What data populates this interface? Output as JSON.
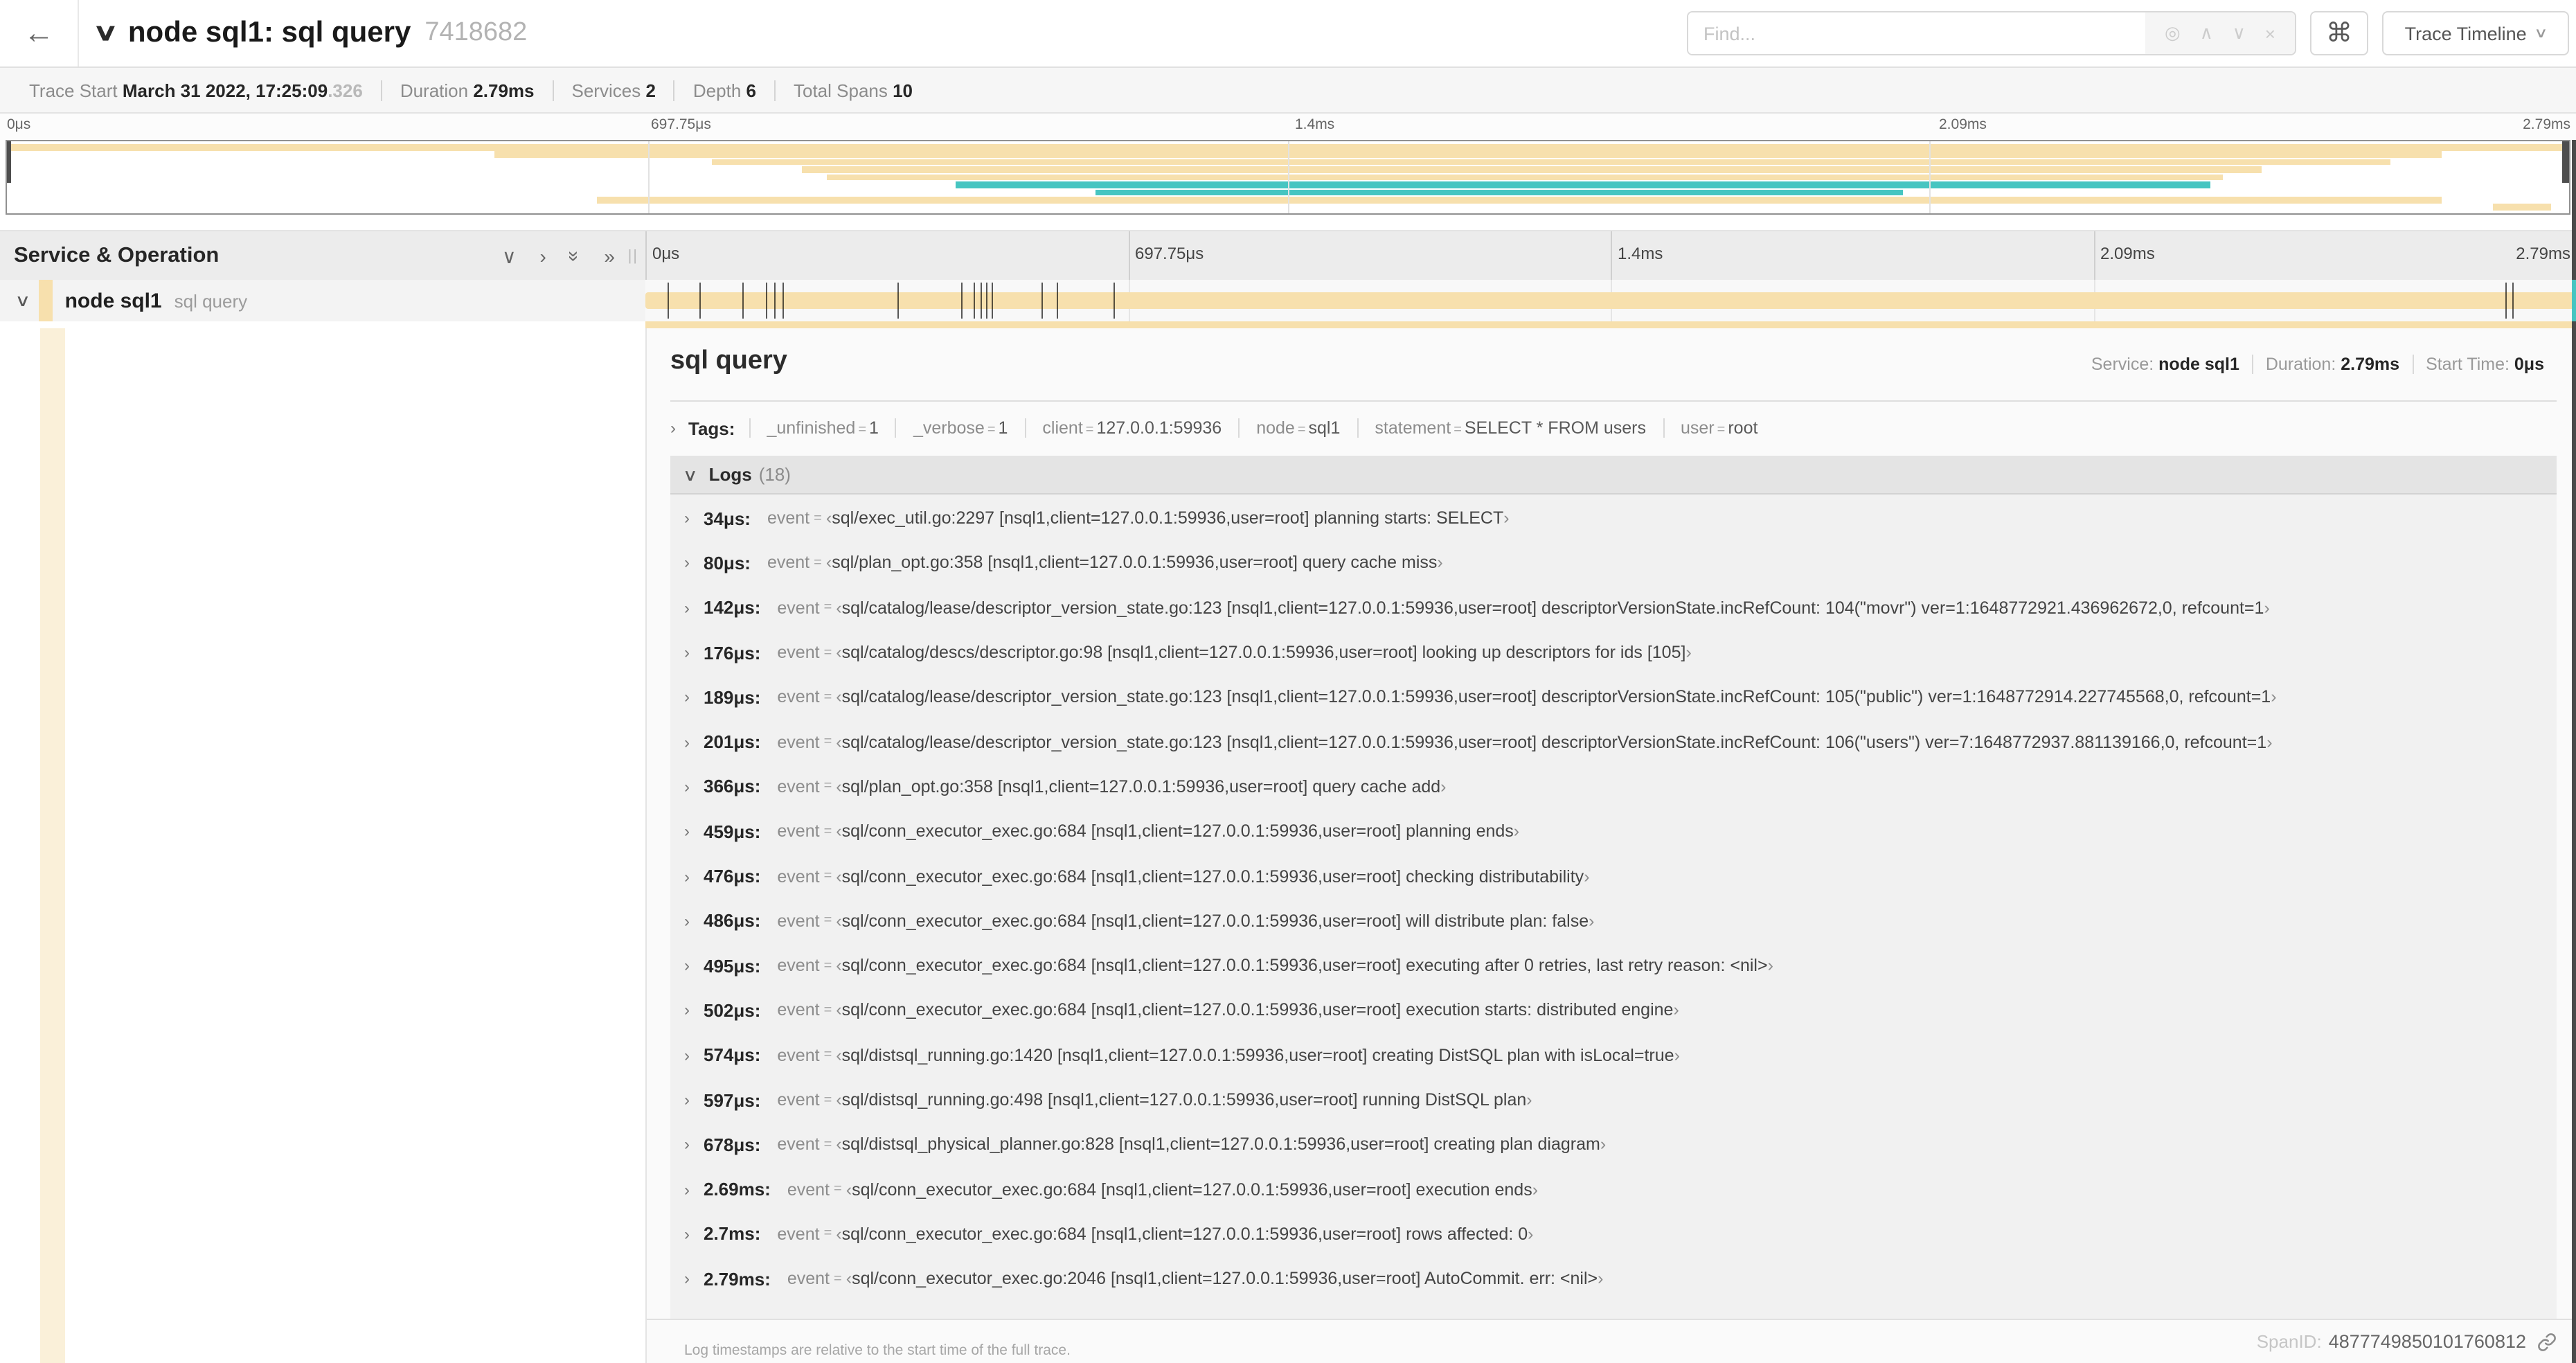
{
  "topbar": {
    "back_icon": "←",
    "collapse_icon": "∨",
    "title": "node sql1: sql query",
    "trace_id": "7418682",
    "find_placeholder": "Find...",
    "locate_icon": "◎",
    "prev_icon": "∧",
    "next_icon": "∨",
    "clear_icon": "×",
    "cmd_symbol": "⌘",
    "view_button": "Trace Timeline"
  },
  "meta": {
    "items": [
      {
        "label": "Trace Start",
        "value": "March 31 2022, 17:25:09",
        "suffix": ".326"
      },
      {
        "label": "Duration",
        "value": "2.79ms"
      },
      {
        "label": "Services",
        "value": "2"
      },
      {
        "label": "Depth",
        "value": "6"
      },
      {
        "label": "Total Spans",
        "value": "10"
      }
    ]
  },
  "timeline": {
    "axis_tick_labels": [
      "0μs",
      "697.75μs",
      "1.4ms",
      "2.09ms",
      "2.79ms"
    ],
    "axis_tick_percents": [
      0,
      25,
      50,
      75,
      100
    ],
    "header_left": "Service & Operation",
    "colors": {
      "tan": "#f7e0ad",
      "teal": "#46c5c1",
      "indent_tan": "#faf0d9"
    },
    "minimap_spans": [
      {
        "start_pct": 0,
        "end_pct": 100,
        "color": "tan"
      },
      {
        "start_pct": 19,
        "end_pct": 95,
        "color": "tan"
      },
      {
        "start_pct": 27.5,
        "end_pct": 93,
        "color": "tan"
      },
      {
        "start_pct": 31,
        "end_pct": 88,
        "color": "tan"
      },
      {
        "start_pct": 32,
        "end_pct": 86.5,
        "color": "tan"
      },
      {
        "start_pct": 37,
        "end_pct": 86,
        "color": "teal"
      },
      {
        "start_pct": 42.5,
        "end_pct": 74,
        "color": "teal"
      },
      {
        "start_pct": 23,
        "end_pct": 95,
        "color": "tan"
      },
      {
        "start_pct": 97,
        "end_pct": 99.3,
        "color": "tan"
      }
    ],
    "span_row": {
      "collapse_icon": "∨",
      "service": "node sql1",
      "operation": "sql query",
      "duration_total_us": 2790,
      "log_markers_us": [
        34,
        80,
        142,
        176,
        189,
        201,
        366,
        459,
        476,
        486,
        495,
        502,
        574,
        597,
        678,
        2690,
        2700,
        2790
      ]
    }
  },
  "detail": {
    "title": "sql query",
    "summary": [
      {
        "label": "Service:",
        "value": "node sql1"
      },
      {
        "label": "Duration:",
        "value": "2.79ms"
      },
      {
        "label": "Start Time:",
        "value": "0μs"
      }
    ],
    "tags_label": "Tags:",
    "tags": [
      {
        "key": "_unfinished",
        "value": "1"
      },
      {
        "key": "_verbose",
        "value": "1"
      },
      {
        "key": "client",
        "value": "127.0.0.1:59936"
      },
      {
        "key": "node",
        "value": "sql1"
      },
      {
        "key": "statement",
        "value": "SELECT * FROM users"
      },
      {
        "key": "user",
        "value": "root"
      }
    ],
    "logs_label": "Logs",
    "logs_count": "(18)",
    "log_field_key": "event",
    "logs": [
      {
        "time": "34μs:",
        "value": "sql/exec_util.go:2297 [nsql1,client=127.0.0.1:59936,user=root] planning starts: SELECT"
      },
      {
        "time": "80μs:",
        "value": "sql/plan_opt.go:358 [nsql1,client=127.0.0.1:59936,user=root] query cache miss"
      },
      {
        "time": "142μs:",
        "value": "sql/catalog/lease/descriptor_version_state.go:123 [nsql1,client=127.0.0.1:59936,user=root] descriptorVersionState.incRefCount: 104(\"movr\") ver=1:1648772921.436962672,0, refcount=1"
      },
      {
        "time": "176μs:",
        "value": "sql/catalog/descs/descriptor.go:98 [nsql1,client=127.0.0.1:59936,user=root] looking up descriptors for ids [105]"
      },
      {
        "time": "189μs:",
        "value": "sql/catalog/lease/descriptor_version_state.go:123 [nsql1,client=127.0.0.1:59936,user=root] descriptorVersionState.incRefCount: 105(\"public\") ver=1:1648772914.227745568,0, refcount=1"
      },
      {
        "time": "201μs:",
        "value": "sql/catalog/lease/descriptor_version_state.go:123 [nsql1,client=127.0.0.1:59936,user=root] descriptorVersionState.incRefCount: 106(\"users\") ver=7:1648772937.881139166,0, refcount=1"
      },
      {
        "time": "366μs:",
        "value": "sql/plan_opt.go:358 [nsql1,client=127.0.0.1:59936,user=root] query cache add"
      },
      {
        "time": "459μs:",
        "value": "sql/conn_executor_exec.go:684 [nsql1,client=127.0.0.1:59936,user=root] planning ends"
      },
      {
        "time": "476μs:",
        "value": "sql/conn_executor_exec.go:684 [nsql1,client=127.0.0.1:59936,user=root] checking distributability"
      },
      {
        "time": "486μs:",
        "value": "sql/conn_executor_exec.go:684 [nsql1,client=127.0.0.1:59936,user=root] will distribute plan: false"
      },
      {
        "time": "495μs:",
        "value": "sql/conn_executor_exec.go:684 [nsql1,client=127.0.0.1:59936,user=root] executing after 0 retries, last retry reason: <nil>"
      },
      {
        "time": "502μs:",
        "value": "sql/conn_executor_exec.go:684 [nsql1,client=127.0.0.1:59936,user=root] execution starts: distributed engine"
      },
      {
        "time": "574μs:",
        "value": "sql/distsql_running.go:1420 [nsql1,client=127.0.0.1:59936,user=root] creating DistSQL plan with isLocal=true"
      },
      {
        "time": "597μs:",
        "value": "sql/distsql_running.go:498 [nsql1,client=127.0.0.1:59936,user=root] running DistSQL plan"
      },
      {
        "time": "678μs:",
        "value": "sql/distsql_physical_planner.go:828 [nsql1,client=127.0.0.1:59936,user=root] creating plan diagram"
      },
      {
        "time": "2.69ms:",
        "value": "sql/conn_executor_exec.go:684 [nsql1,client=127.0.0.1:59936,user=root] execution ends"
      },
      {
        "time": "2.7ms:",
        "value": "sql/conn_executor_exec.go:684 [nsql1,client=127.0.0.1:59936,user=root] rows affected: 0"
      },
      {
        "time": "2.79ms:",
        "value": "sql/conn_executor_exec.go:2046 [nsql1,client=127.0.0.1:59936,user=root] AutoCommit. err: <nil>"
      }
    ],
    "footer": "Log timestamps are relative to the start time of the full trace.",
    "spanid_label": "SpanID:",
    "spanid_value": "4877749850101760812"
  }
}
